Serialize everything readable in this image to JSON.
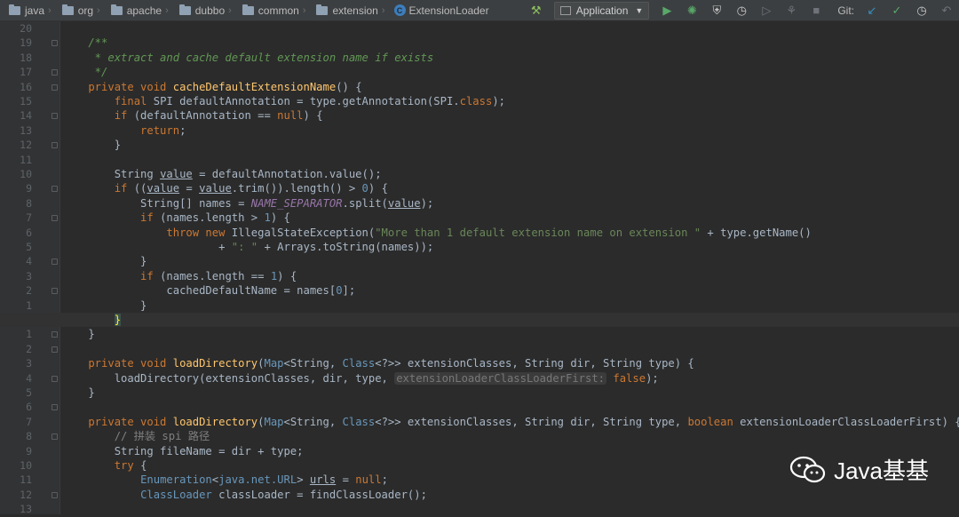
{
  "breadcrumbs": [
    "java",
    "org",
    "apache",
    "dubbo",
    "common",
    "extension"
  ],
  "current_class": {
    "label": "ExtensionLoader",
    "icon": "C"
  },
  "run_configuration": "Application",
  "git_label": "Git:",
  "watermark_text": "Java基基",
  "code_lines": [
    {
      "num": "20",
      "tokens": []
    },
    {
      "num": "19",
      "tokens": [
        {
          "c": "cm",
          "t": "    /**"
        }
      ]
    },
    {
      "num": "18",
      "tokens": [
        {
          "c": "cm",
          "t": "     * extract and cache default extension name if exists"
        }
      ]
    },
    {
      "num": "17",
      "tokens": [
        {
          "c": "cm",
          "t": "     */"
        }
      ]
    },
    {
      "num": "16",
      "tokens": [
        {
          "c": "kw",
          "t": "    private void "
        },
        {
          "c": "fn",
          "t": "cacheDefaultExtensionName"
        },
        {
          "c": "tx",
          "t": "() {"
        }
      ]
    },
    {
      "num": "15",
      "tokens": [
        {
          "c": "kw",
          "t": "        final "
        },
        {
          "c": "tx",
          "t": "SPI defaultAnnotation = "
        },
        {
          "c": "tx",
          "t": "type"
        },
        {
          "c": "tx",
          "t": ".getAnnotation("
        },
        {
          "c": "tx",
          "t": "SPI."
        },
        {
          "c": "kw",
          "t": "class"
        },
        {
          "c": "tx",
          "t": ");"
        }
      ]
    },
    {
      "num": "14",
      "tokens": [
        {
          "c": "kw",
          "t": "        if "
        },
        {
          "c": "tx",
          "t": "(defaultAnnotation == "
        },
        {
          "c": "kw",
          "t": "null"
        },
        {
          "c": "tx",
          "t": ") {"
        }
      ]
    },
    {
      "num": "13",
      "tokens": [
        {
          "c": "kw",
          "t": "            return"
        },
        {
          "c": "tx",
          "t": ";"
        }
      ]
    },
    {
      "num": "12",
      "tokens": [
        {
          "c": "tx",
          "t": "        }"
        }
      ]
    },
    {
      "num": "11",
      "tokens": []
    },
    {
      "num": "10",
      "tokens": [
        {
          "c": "tx",
          "t": "        String "
        },
        {
          "c": "ul",
          "t": "value"
        },
        {
          "c": "tx",
          "t": " = defaultAnnotation.value();"
        }
      ]
    },
    {
      "num": "9",
      "tokens": [
        {
          "c": "kw",
          "t": "        if "
        },
        {
          "c": "tx",
          "t": "(("
        },
        {
          "c": "ul",
          "t": "value"
        },
        {
          "c": "tx",
          "t": " = "
        },
        {
          "c": "ul",
          "t": "value"
        },
        {
          "c": "tx",
          "t": ".trim()).length() > "
        },
        {
          "c": "nm",
          "t": "0"
        },
        {
          "c": "tx",
          "t": ") {"
        }
      ]
    },
    {
      "num": "8",
      "tokens": [
        {
          "c": "tx",
          "t": "            String[] names = "
        },
        {
          "c": "cn",
          "t": "NAME_SEPARATOR"
        },
        {
          "c": "tx",
          "t": ".split("
        },
        {
          "c": "ul",
          "t": "value"
        },
        {
          "c": "tx",
          "t": ");"
        }
      ]
    },
    {
      "num": "7",
      "tokens": [
        {
          "c": "kw",
          "t": "            if "
        },
        {
          "c": "tx",
          "t": "(names."
        },
        {
          "c": "tx",
          "t": "length"
        },
        {
          "c": "tx",
          "t": " > "
        },
        {
          "c": "nm",
          "t": "1"
        },
        {
          "c": "tx",
          "t": ") {"
        }
      ]
    },
    {
      "num": "6",
      "tokens": [
        {
          "c": "kw",
          "t": "                throw new "
        },
        {
          "c": "tx",
          "t": "IllegalStateException("
        },
        {
          "c": "st",
          "t": "\"More than 1 default extension name on extension \""
        },
        {
          "c": "tx",
          "t": " + "
        },
        {
          "c": "tx",
          "t": "type"
        },
        {
          "c": "tx",
          "t": ".getName()"
        }
      ]
    },
    {
      "num": "5",
      "tokens": [
        {
          "c": "tx",
          "t": "                        + "
        },
        {
          "c": "st",
          "t": "\": \""
        },
        {
          "c": "tx",
          "t": " + Arrays."
        },
        {
          "c": "tx",
          "t": "toString"
        },
        {
          "c": "tx",
          "t": "(names));"
        }
      ]
    },
    {
      "num": "4",
      "tokens": [
        {
          "c": "tx",
          "t": "            }"
        }
      ]
    },
    {
      "num": "3",
      "tokens": [
        {
          "c": "kw",
          "t": "            if "
        },
        {
          "c": "tx",
          "t": "(names."
        },
        {
          "c": "tx",
          "t": "length"
        },
        {
          "c": "tx",
          "t": " == "
        },
        {
          "c": "nm",
          "t": "1"
        },
        {
          "c": "tx",
          "t": ") {"
        }
      ]
    },
    {
      "num": "2",
      "tokens": [
        {
          "c": "tx",
          "t": "                cachedDefaultName = names["
        },
        {
          "c": "nm",
          "t": "0"
        },
        {
          "c": "tx",
          "t": "];"
        }
      ]
    },
    {
      "num": "1",
      "tokens": [
        {
          "c": "tx",
          "t": "            }"
        }
      ]
    },
    {
      "num": "",
      "current": true,
      "tokens": [
        {
          "c": "tx",
          "t": "        "
        },
        {
          "c": "brace-hl",
          "t": "}"
        }
      ]
    },
    {
      "num": "1",
      "tokens": [
        {
          "c": "tx",
          "t": "    }"
        }
      ]
    },
    {
      "num": "2",
      "tokens": []
    },
    {
      "num": "3",
      "tokens": [
        {
          "c": "kw",
          "t": "    private void "
        },
        {
          "c": "fn",
          "t": "loadDirectory"
        },
        {
          "c": "tx",
          "t": "("
        },
        {
          "c": "ty",
          "t": "Map"
        },
        {
          "c": "tx",
          "t": "<String, "
        },
        {
          "c": "ty",
          "t": "Class"
        },
        {
          "c": "tx",
          "t": "<?>> extensionClasses, String dir, String type) {"
        }
      ]
    },
    {
      "num": "4",
      "tokens": [
        {
          "c": "tx",
          "t": "        loadDirectory(extensionClasses, dir, type, "
        },
        {
          "c": "hint",
          "t": "extensionLoaderClassLoaderFirst:"
        },
        {
          "c": "kw",
          "t": " false"
        },
        {
          "c": "tx",
          "t": ");"
        }
      ]
    },
    {
      "num": "5",
      "tokens": [
        {
          "c": "tx",
          "t": "    }"
        }
      ]
    },
    {
      "num": "6",
      "tokens": []
    },
    {
      "num": "7",
      "tokens": [
        {
          "c": "kw",
          "t": "    private void "
        },
        {
          "c": "fn",
          "t": "loadDirectory"
        },
        {
          "c": "tx",
          "t": "("
        },
        {
          "c": "ty",
          "t": "Map"
        },
        {
          "c": "tx",
          "t": "<String, "
        },
        {
          "c": "ty",
          "t": "Class"
        },
        {
          "c": "tx",
          "t": "<?>> extensionClasses, String dir, String type, "
        },
        {
          "c": "kw",
          "t": "boolean "
        },
        {
          "c": "tx",
          "t": "extensionLoaderClassLoaderFirst) {"
        }
      ]
    },
    {
      "num": "8",
      "tokens": [
        {
          "c": "lc",
          "t": "        // 拼装 spi 路径"
        }
      ]
    },
    {
      "num": "9",
      "tokens": [
        {
          "c": "tx",
          "t": "        String fileName = dir + type;"
        }
      ]
    },
    {
      "num": "10",
      "tokens": [
        {
          "c": "kw",
          "t": "        try "
        },
        {
          "c": "tx",
          "t": "{"
        }
      ]
    },
    {
      "num": "11",
      "tokens": [
        {
          "c": "tx",
          "t": "            "
        },
        {
          "c": "ty",
          "t": "Enumeration"
        },
        {
          "c": "tx",
          "t": "<"
        },
        {
          "c": "ty",
          "t": "java.net.URL"
        },
        {
          "c": "tx",
          "t": "> "
        },
        {
          "c": "ul",
          "t": "urls"
        },
        {
          "c": "tx",
          "t": " = "
        },
        {
          "c": "kw",
          "t": "null"
        },
        {
          "c": "tx",
          "t": ";"
        }
      ]
    },
    {
      "num": "12",
      "tokens": [
        {
          "c": "tx",
          "t": "            "
        },
        {
          "c": "ty",
          "t": "ClassLoader"
        },
        {
          "c": "tx",
          "t": " classLoader = findClassLoader();"
        }
      ]
    },
    {
      "num": "13",
      "tokens": []
    }
  ]
}
